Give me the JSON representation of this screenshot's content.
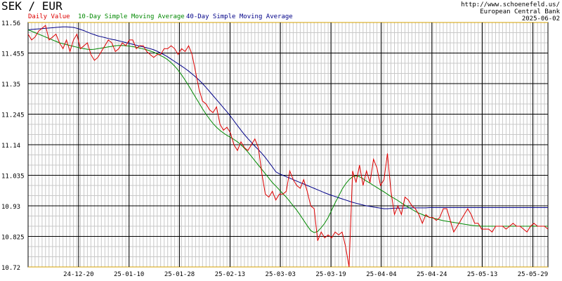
{
  "chart_data": {
    "type": "line",
    "title": "SEK / EUR",
    "source": {
      "url": "http://www.schoenefeld.us/",
      "bank": "European Central Bank",
      "date": "2025-06-02"
    },
    "ylim": [
      10.72,
      11.56
    ],
    "y_tick_labels": [
      "11.56",
      "11.455",
      "11.35",
      "11.245",
      "11.14",
      "11.035",
      "10.93",
      "10.825",
      "10.72"
    ],
    "y_tick_values": [
      11.56,
      11.455,
      11.35,
      11.245,
      11.14,
      11.035,
      10.93,
      10.825,
      10.72
    ],
    "x_tick_labels": [
      "24-12-20",
      "25-01-10",
      "25-01-28",
      "25-02-13",
      "25-03-03",
      "25-03-19",
      "25-04-04",
      "25-04-24",
      "25-05-13",
      "25-05-29"
    ],
    "x_tick_indices": [
      10,
      20,
      30,
      40,
      50,
      60,
      70,
      80,
      90,
      100
    ],
    "grid": true,
    "legend_position": "top-left",
    "series": [
      {
        "name": "Daily Value",
        "color": "#dd0000",
        "values": [
          11.52,
          11.5,
          11.51,
          11.53,
          11.54,
          11.55,
          11.5,
          11.51,
          11.52,
          11.49,
          11.47,
          11.5,
          11.46,
          11.5,
          11.52,
          11.47,
          11.48,
          11.49,
          11.45,
          11.43,
          11.44,
          11.46,
          11.48,
          11.5,
          11.49,
          11.46,
          11.47,
          11.49,
          11.48,
          11.5,
          11.5,
          11.47,
          11.48,
          11.48,
          11.46,
          11.45,
          11.44,
          11.45,
          11.45,
          11.47,
          11.47,
          11.48,
          11.47,
          11.45,
          11.47,
          11.46,
          11.48,
          11.45,
          11.39,
          11.33,
          11.29,
          11.28,
          11.26,
          11.25,
          11.27,
          11.21,
          11.19,
          11.2,
          11.18,
          11.14,
          11.12,
          11.15,
          11.13,
          11.12,
          11.14,
          11.16,
          11.13,
          11.04,
          10.97,
          10.96,
          10.98,
          10.95,
          10.97,
          10.97,
          10.98,
          11.05,
          11.02,
          11.0,
          10.99,
          11.02,
          10.98,
          10.93,
          10.92,
          10.81,
          10.84,
          10.82,
          10.83,
          10.82,
          10.84,
          10.83,
          10.84,
          10.79,
          10.72,
          11.05,
          11.01,
          11.07,
          11.0,
          11.05,
          11.01,
          11.09,
          11.06,
          11.0,
          11.02,
          11.11,
          10.98,
          10.9,
          10.93,
          10.9,
          10.96,
          10.95,
          10.93,
          10.92,
          10.9,
          10.87,
          10.9,
          10.89,
          10.89,
          10.88,
          10.89,
          10.92,
          10.92,
          10.88,
          10.84,
          10.86,
          10.88,
          10.9,
          10.92,
          10.9,
          10.87,
          10.87,
          10.85,
          10.85,
          10.85,
          10.84,
          10.86,
          10.86,
          10.86,
          10.85,
          10.86,
          10.87,
          10.86,
          10.86,
          10.85,
          10.84,
          10.86,
          10.87,
          10.86,
          10.86,
          10.86,
          10.85
        ]
      },
      {
        "name": "10-Day Simple Moving Average",
        "color": "#008800",
        "values": [
          11.535,
          11.53,
          11.525,
          11.52,
          11.515,
          11.51,
          11.505,
          11.5,
          11.495,
          11.49,
          11.487,
          11.484,
          11.481,
          11.478,
          11.475,
          11.472,
          11.47,
          11.468,
          11.467,
          11.468,
          11.47,
          11.472,
          11.474,
          11.476,
          11.478,
          11.48,
          11.481,
          11.481,
          11.48,
          11.479,
          11.477,
          11.475,
          11.472,
          11.469,
          11.466,
          11.462,
          11.458,
          11.452,
          11.446,
          11.44,
          11.432,
          11.422,
          11.41,
          11.396,
          11.38,
          11.362,
          11.343,
          11.323,
          11.303,
          11.283,
          11.263,
          11.245,
          11.228,
          11.213,
          11.2,
          11.189,
          11.18,
          11.172,
          11.165,
          11.158,
          11.15,
          11.14,
          11.128,
          11.115,
          11.1,
          11.085,
          11.07,
          11.055,
          11.04,
          11.025,
          11.01,
          10.998,
          10.985,
          10.972,
          10.96,
          10.945,
          10.93,
          10.915,
          10.898,
          10.88,
          10.862,
          10.845,
          10.838,
          10.842,
          10.855,
          10.87,
          10.89,
          10.915,
          10.94,
          10.963,
          10.987,
          11.005,
          11.02,
          11.03,
          11.033,
          11.03,
          11.023,
          11.015,
          11.008,
          11.0,
          10.993,
          10.985,
          10.978,
          10.97,
          10.962,
          10.955,
          10.948,
          10.94,
          10.932,
          10.925,
          10.918,
          10.911,
          10.905,
          10.9,
          10.895,
          10.891,
          10.888,
          10.885,
          10.882,
          10.879,
          10.877,
          10.875,
          10.873,
          10.871,
          10.869,
          10.867,
          10.865,
          10.863,
          10.862,
          10.861,
          10.86,
          10.86,
          10.86,
          10.86,
          10.86,
          10.86,
          10.86,
          10.86,
          10.86,
          10.86,
          10.86,
          10.86,
          10.86,
          10.86,
          10.86,
          10.86,
          10.86,
          10.86,
          10.86,
          10.86
        ]
      },
      {
        "name": "40-Day Simple Moving Average",
        "color": "#000088",
        "values": [
          11.535,
          11.536,
          11.537,
          11.538,
          11.539,
          11.54,
          11.541,
          11.542,
          11.543,
          11.544,
          11.545,
          11.545,
          11.544,
          11.543,
          11.54,
          11.536,
          11.532,
          11.527,
          11.522,
          11.518,
          11.514,
          11.511,
          11.508,
          11.505,
          11.502,
          11.5,
          11.497,
          11.494,
          11.491,
          11.488,
          11.485,
          11.482,
          11.479,
          11.476,
          11.473,
          11.47,
          11.466,
          11.461,
          11.455,
          11.449,
          11.442,
          11.434,
          11.426,
          11.418,
          11.41,
          11.402,
          11.393,
          11.383,
          11.373,
          11.362,
          11.35,
          11.337,
          11.323,
          11.309,
          11.295,
          11.281,
          11.267,
          11.253,
          11.238,
          11.222,
          11.206,
          11.19,
          11.175,
          11.161,
          11.148,
          11.135,
          11.123,
          11.11,
          11.096,
          11.08,
          11.064,
          11.047,
          11.04,
          11.035,
          11.03,
          11.025,
          11.02,
          11.015,
          11.01,
          11.005,
          11.0,
          10.995,
          10.99,
          10.985,
          10.98,
          10.975,
          10.97,
          10.966,
          10.962,
          10.958,
          10.954,
          10.95,
          10.946,
          10.942,
          10.939,
          10.936,
          10.933,
          10.93,
          10.928,
          10.926,
          10.924,
          10.922,
          10.92,
          10.92,
          10.921,
          10.922,
          10.922,
          10.922,
          10.922,
          10.923,
          10.923,
          10.923,
          10.923,
          10.923,
          10.923,
          10.924,
          10.924,
          10.924,
          10.924,
          10.924,
          10.924,
          10.924,
          10.924,
          10.924,
          10.924,
          10.924,
          10.924,
          10.924,
          10.924,
          10.924,
          10.924,
          10.924,
          10.924,
          10.924,
          10.924,
          10.924,
          10.924,
          10.924,
          10.924,
          10.924,
          10.924,
          10.924,
          10.924,
          10.924,
          10.924,
          10.924,
          10.924,
          10.924,
          10.924,
          10.924
        ]
      }
    ]
  }
}
